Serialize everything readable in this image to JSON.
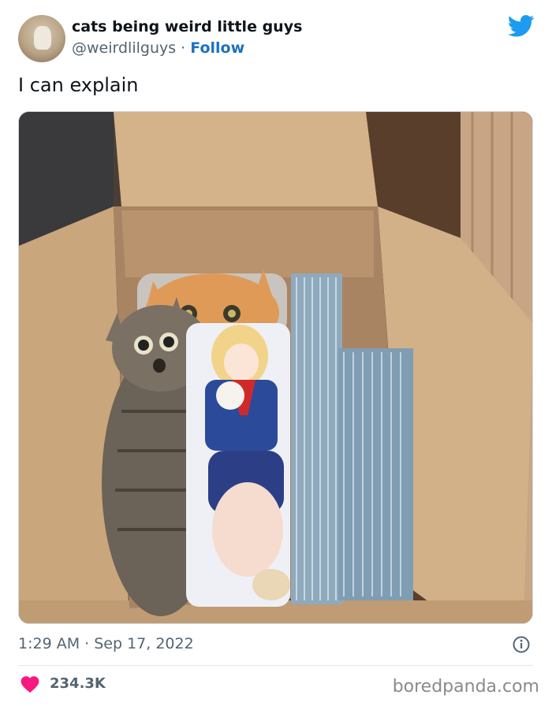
{
  "tweet": {
    "author_name": "cats being weird little guys",
    "author_handle": "@weirdlilguys",
    "separator": " · ",
    "follow_label": "Follow",
    "text": "I can explain",
    "timestamp": "1:29 AM · Sep 17, 2022",
    "like_count": "234.3K"
  },
  "icons": {
    "brand": "twitter-bird-icon",
    "info": "info-icon",
    "like": "heart-icon"
  },
  "watermark": "boredpanda.com",
  "colors": {
    "follow_link": "#1d72c2",
    "twitter_blue": "#1d9bf0",
    "heart": "#f91880",
    "secondary_text": "#536471"
  }
}
